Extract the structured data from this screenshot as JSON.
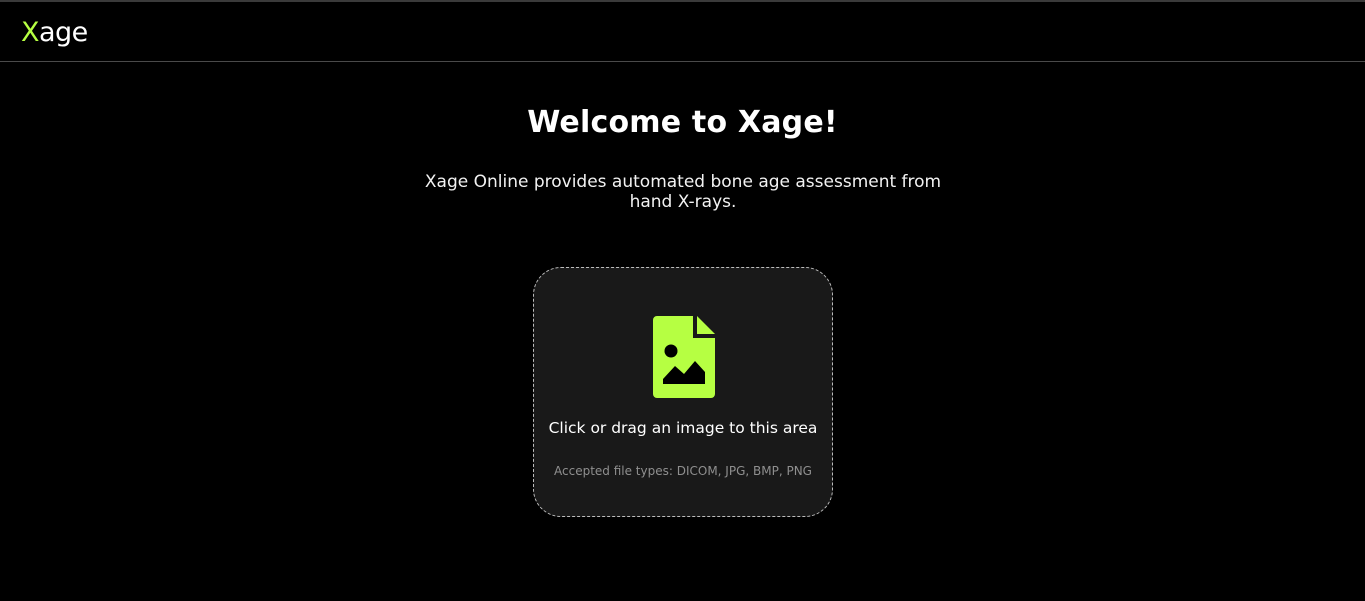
{
  "header": {
    "logo_first": "X",
    "logo_rest": "age"
  },
  "main": {
    "title": "Welcome to Xage!",
    "subtitle": "Xage Online provides automated bone age assessment from hand X-rays."
  },
  "upload": {
    "icon": "image-file-icon",
    "main_text": "Click or drag an image to this area",
    "hint_text": "Accepted file types: DICOM, JPG, BMP, PNG"
  },
  "colors": {
    "background": "#000000",
    "accent": "#b6ff42",
    "dropzone_bg": "#191919",
    "hint_text": "#8f8f8f"
  }
}
